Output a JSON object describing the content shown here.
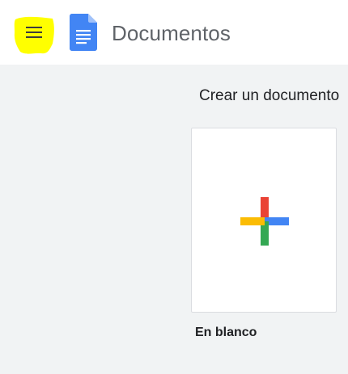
{
  "header": {
    "app_title": "Documentos",
    "menu_icon": "hamburger-menu-icon",
    "logo_icon": "google-docs-logo-icon"
  },
  "templates": {
    "section_title": "Crear un documento",
    "items": [
      {
        "label": "En blanco",
        "icon": "colorful-plus-icon"
      }
    ]
  },
  "colors": {
    "highlight": "#ffff00",
    "docs_blue": "#4285f4",
    "plus_red": "#ea4335",
    "plus_blue": "#4285f4",
    "plus_green": "#34a853",
    "plus_yellow": "#fbbc04",
    "background": "#f1f3f4"
  }
}
